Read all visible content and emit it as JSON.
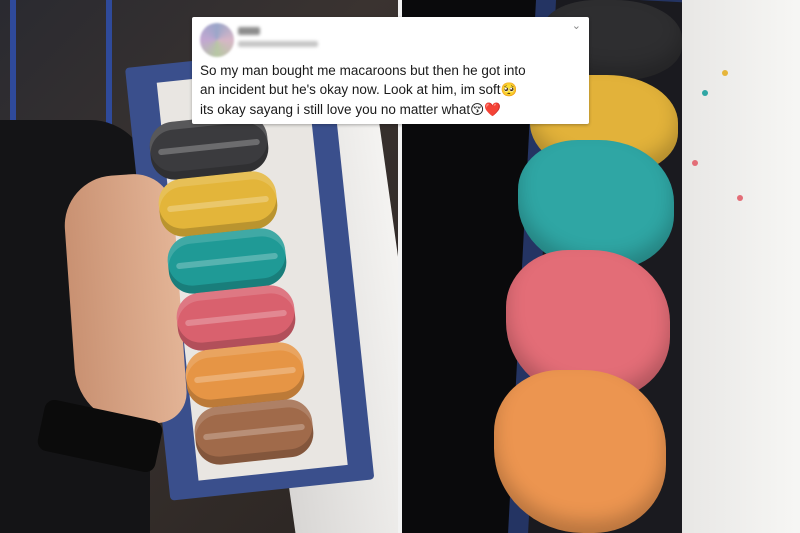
{
  "tweet": {
    "lines": [
      "So my man bought me macaroons but then he got into",
      "an incident but he's okay now. Look at him, im soft",
      " its okay sayang i still love you no matter what"
    ],
    "emoji_soft": "🥺",
    "emoji_kiss": "😚",
    "emoji_heart": "❤️"
  },
  "photos": {
    "left": {
      "subject": "boxed-macarons-intact",
      "macaron_colors": [
        "#3b3b3e",
        "#e3b53a",
        "#1f9a96",
        "#d9616e",
        "#e69545",
        "#a06a4a"
      ]
    },
    "right": {
      "subject": "boxed-macarons-crushed",
      "macaron_colors": [
        "#2e2e30",
        "#e2b23a",
        "#2fa6a4",
        "#e36d77",
        "#ec9550"
      ]
    }
  }
}
